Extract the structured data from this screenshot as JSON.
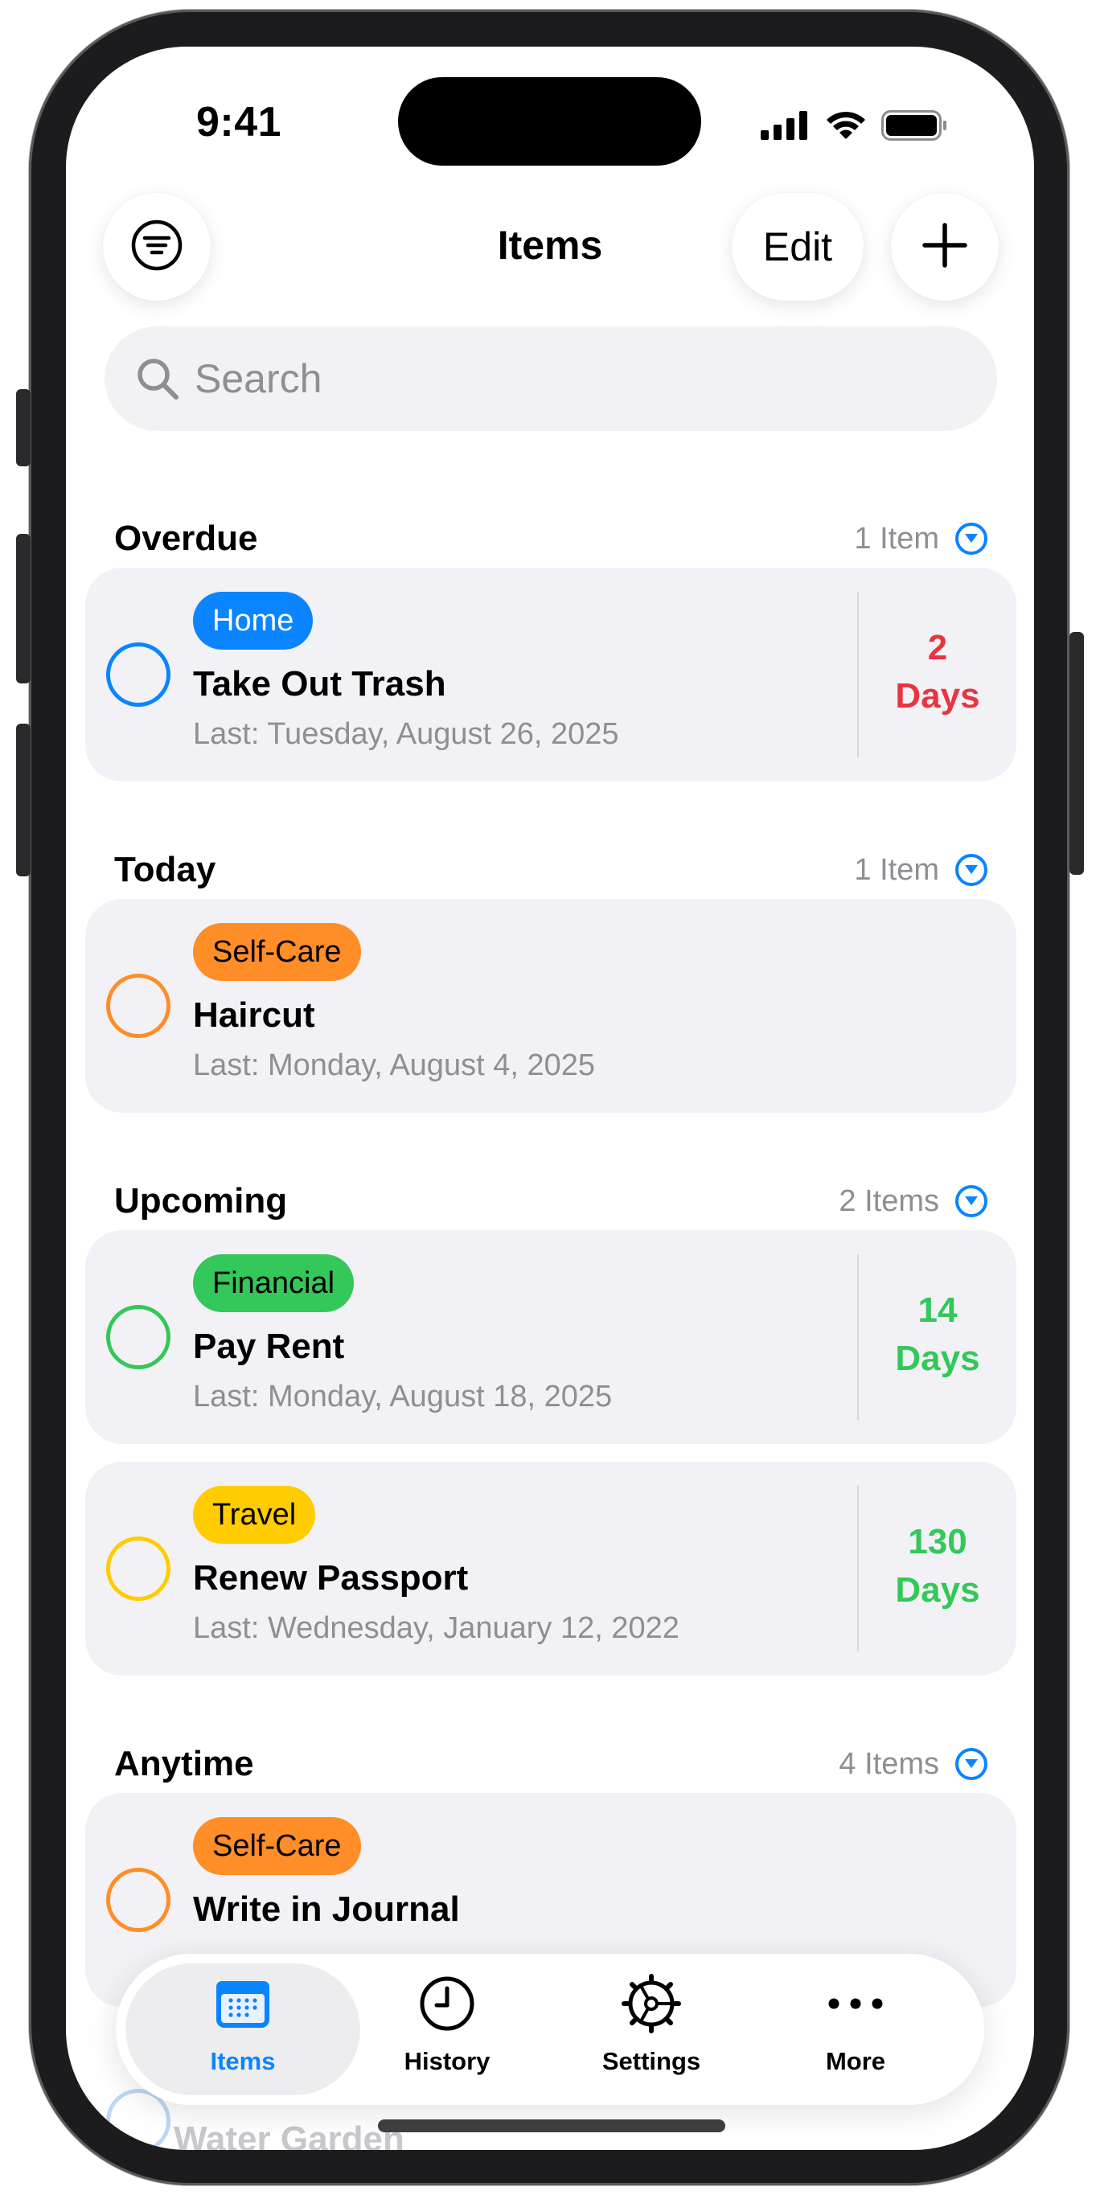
{
  "status_bar": {
    "time": "9:41"
  },
  "nav": {
    "title": "Items",
    "edit_label": "Edit"
  },
  "search": {
    "placeholder": "Search"
  },
  "colors": {
    "accent": "#0A84FF",
    "overdue_red": "#E8353F",
    "upcoming_green": "#34C759",
    "home_blue": "#0A84FF",
    "selfcare_orange": "#FF8D28",
    "financial_green": "#34C759",
    "travel_yellow": "#FFCC00"
  },
  "sections": [
    {
      "title": "Overdue",
      "count": "1 Item"
    },
    {
      "title": "Today",
      "count": "1 Item"
    },
    {
      "title": "Upcoming",
      "count": "2 Items"
    },
    {
      "title": "Anytime",
      "count": "4 Items"
    }
  ],
  "items": [
    {
      "tag": "Home",
      "title": "Take Out Trash",
      "last": "Last: Tuesday, August 26, 2025",
      "days_num": "2",
      "days_unit": "Days",
      "status": "overdue"
    },
    {
      "tag": "Self-Care",
      "title": "Haircut",
      "last": "Last: Monday, August 4, 2025",
      "status": "today"
    },
    {
      "tag": "Financial",
      "title": "Pay Rent",
      "last": "Last: Monday, August 18, 2025",
      "days_num": "14",
      "days_unit": "Days",
      "status": "upcoming"
    },
    {
      "tag": "Travel",
      "title": "Renew Passport",
      "last": "Last: Wednesday, January 12, 2022",
      "days_num": "130",
      "days_unit": "Days",
      "status": "upcoming"
    },
    {
      "tag": "Self-Care",
      "title": "Write in Journal",
      "status": "anytime"
    },
    {
      "title": "Water Garden",
      "status": "anytime"
    }
  ],
  "tabbar": {
    "tabs": [
      {
        "label": "Items",
        "icon": "calendar-icon",
        "selected": true
      },
      {
        "label": "History",
        "icon": "clock-icon",
        "selected": false
      },
      {
        "label": "Settings",
        "icon": "gear-icon",
        "selected": false
      },
      {
        "label": "More",
        "icon": "ellipsis-icon",
        "selected": false
      }
    ]
  }
}
